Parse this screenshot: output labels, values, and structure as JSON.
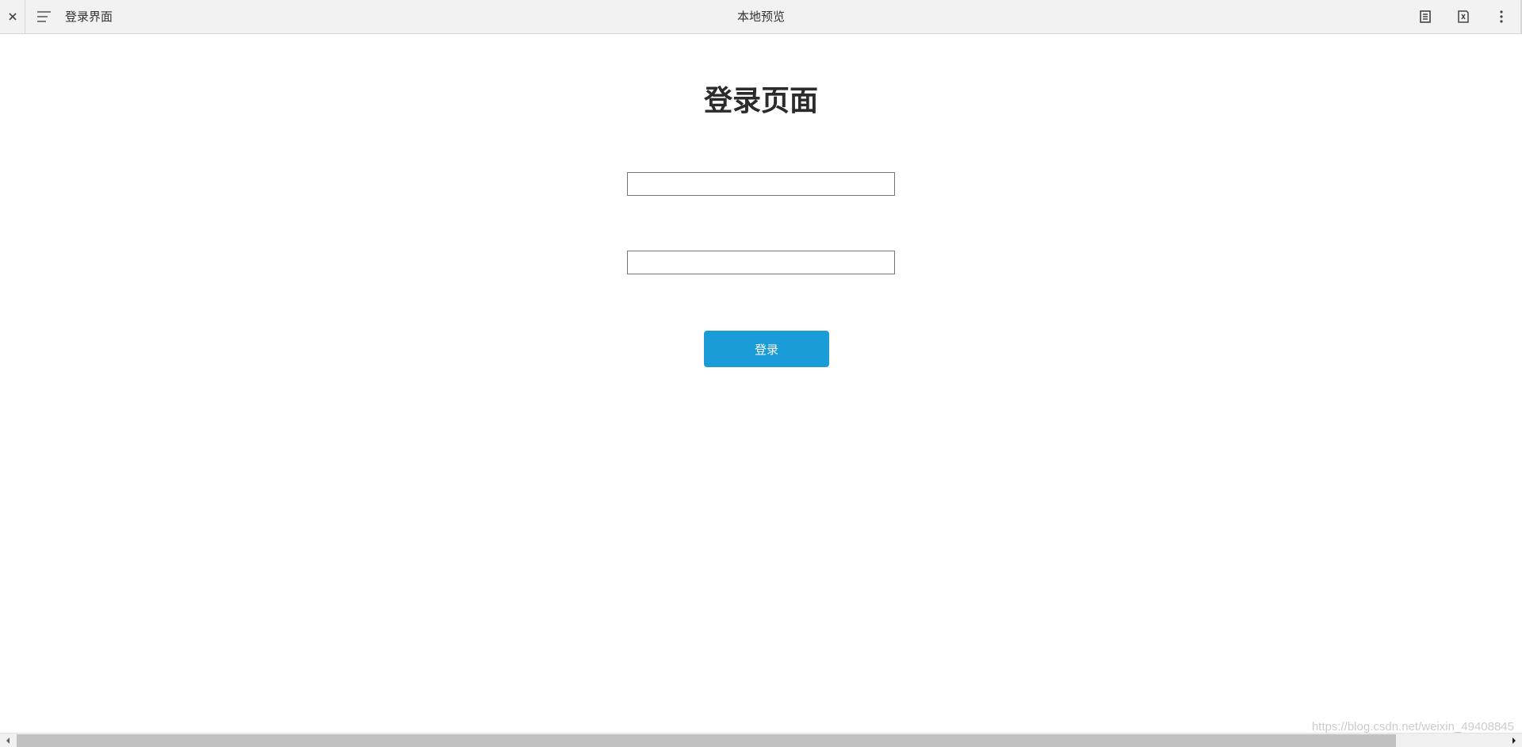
{
  "toolbar": {
    "close_glyph": "✕",
    "document_title": "登录界面",
    "center_title": "本地预览"
  },
  "page": {
    "title": "登录页面",
    "username": {
      "value": "",
      "placeholder": ""
    },
    "password": {
      "value": "",
      "placeholder": ""
    },
    "login_label": "登录"
  },
  "watermark": "https://blog.csdn.net/weixin_49408845",
  "icons": {
    "close": "close-icon",
    "menu": "menu-icon",
    "reader": "document-icon",
    "export": "export-icon",
    "more": "more-vertical-icon",
    "scroll_left": "triangle-left-icon",
    "scroll_right": "triangle-right-icon"
  },
  "colors": {
    "toolbar_bg": "#f2f2f2",
    "button_bg": "#1a9cd6",
    "button_text": "#ffffff",
    "title_text": "#2b2b2b",
    "scroll_thumb": "#c1c1c1"
  }
}
